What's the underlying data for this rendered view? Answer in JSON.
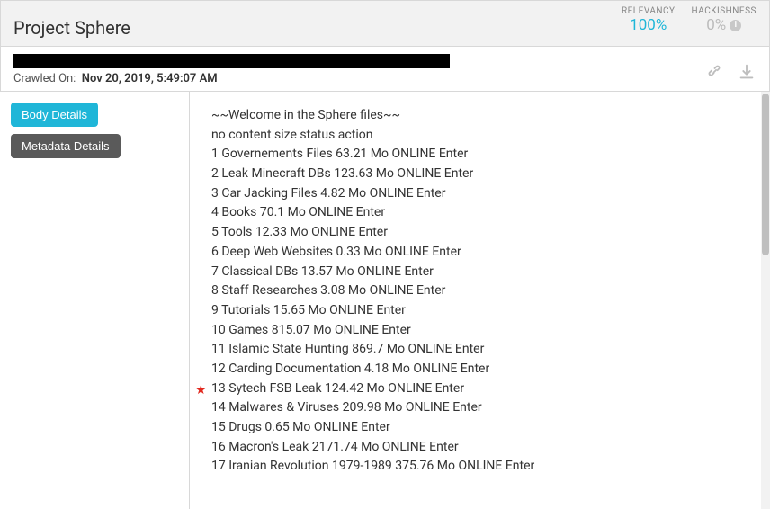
{
  "header": {
    "title": "Project Sphere",
    "metrics": {
      "relevancy": {
        "label": "RELEVANCY",
        "value": "100%"
      },
      "hackishness": {
        "label": "HACKISHNESS",
        "value": "0%"
      }
    },
    "crawl_label": "Crawled On:",
    "crawl_value": "Nov 20, 2019, 5:49:07 AM"
  },
  "sidebar": {
    "body_details": "Body Details",
    "metadata_details": "Metadata Details"
  },
  "content": {
    "welcome": "~~Welcome in the Sphere files~~",
    "header_row": "no content size status action",
    "rows": [
      {
        "text": "1 Governements Files 63.21 Mo ONLINE Enter",
        "star": false
      },
      {
        "text": "2 Leak Minecraft DBs 123.63 Mo ONLINE Enter",
        "star": false
      },
      {
        "text": "3 Car Jacking Files 4.82 Mo ONLINE Enter",
        "star": false
      },
      {
        "text": "4 Books 70.1 Mo ONLINE Enter",
        "star": false
      },
      {
        "text": "5 Tools 12.33 Mo ONLINE Enter",
        "star": false
      },
      {
        "text": "6 Deep Web Websites 0.33 Mo ONLINE Enter",
        "star": false
      },
      {
        "text": "7 Classical DBs 13.57 Mo ONLINE Enter",
        "star": false
      },
      {
        "text": "8 Staff Researches 3.08 Mo ONLINE Enter",
        "star": false
      },
      {
        "text": "9 Tutorials 15.65 Mo ONLINE Enter",
        "star": false
      },
      {
        "text": "10 Games 815.07 Mo ONLINE Enter",
        "star": false
      },
      {
        "text": "11 Islamic State Hunting 869.7 Mo ONLINE Enter",
        "star": false
      },
      {
        "text": "12 Carding Documentation 4.18 Mo ONLINE Enter",
        "star": false
      },
      {
        "text": "13 Sytech FSB Leak 124.42 Mo ONLINE Enter",
        "star": true
      },
      {
        "text": "14 Malwares & Viruses 209.98 Mo ONLINE Enter",
        "star": false
      },
      {
        "text": "15 Drugs 0.65 Mo ONLINE Enter",
        "star": false
      },
      {
        "text": "16 Macron's Leak 2171.74 Mo ONLINE Enter",
        "star": false
      },
      {
        "text": "17 Iranian Revolution 1979-1989 375.76 Mo ONLINE Enter",
        "star": false
      }
    ]
  }
}
